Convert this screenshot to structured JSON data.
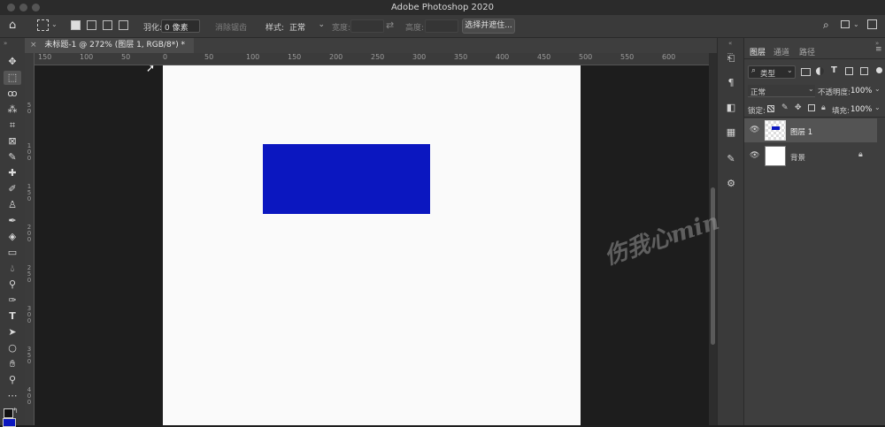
{
  "app": {
    "title": "Adobe Photoshop 2020",
    "colors": {
      "canvas_fill": "#0b17c0",
      "canvas_bg": "#fafafa",
      "ui_bg": "#3a3a3a"
    }
  },
  "options_bar": {
    "feather_label": "羽化:",
    "feather_value": "0 像素",
    "antialias_label": "消除锯齿",
    "style_label": "样式:",
    "style_value": "正常",
    "width_label": "宽度:",
    "height_label": "高度:",
    "select_mask_button": "选择并遮住..."
  },
  "document": {
    "tab_label": "未标题-1 @ 272% (图层 1, RGB/8*) *"
  },
  "rulers": {
    "horizontal": [
      "150",
      "100",
      "50",
      "0",
      "50",
      "100",
      "150",
      "200",
      "250",
      "300",
      "350",
      "400",
      "450",
      "500",
      "550",
      "600"
    ],
    "vertical": [
      "5 0",
      "1 0 0",
      "1 5 0",
      "2 0 0",
      "2 5 0",
      "3 0 0",
      "3 5 0",
      "4 0 0"
    ]
  },
  "layers_panel": {
    "tabs": [
      "图层",
      "通道",
      "路径"
    ],
    "filter_label": "类型",
    "blend_mode": "正常",
    "opacity_label": "不透明度:",
    "opacity_value": "100%",
    "lock_label": "锁定:",
    "fill_label": "填充:",
    "fill_value": "100%",
    "layers": [
      {
        "name": "图层 1",
        "selected": true
      },
      {
        "name": "背景",
        "selected": false,
        "locked": true
      }
    ]
  },
  "watermark": "伤我心min"
}
